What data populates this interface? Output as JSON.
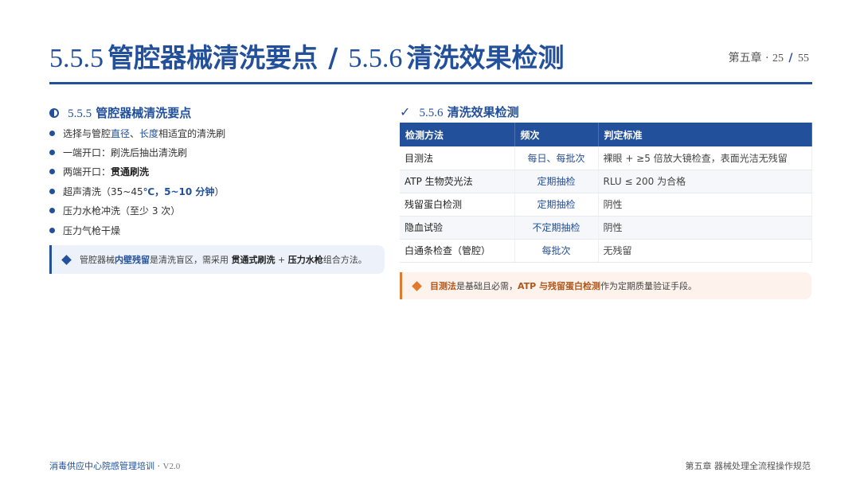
{
  "header": {
    "title_num_1": "5.5.5",
    "title_text_1": "管腔器械清洗要点",
    "title_sep": "/",
    "title_num_2": "5.5.6",
    "title_text_2": "清洗效果检测",
    "chapter": "第五章",
    "dot": "·",
    "page_current": "25",
    "page_sep": "/",
    "page_total": "55"
  },
  "left": {
    "heading_num": "5.5.5",
    "heading_text": "管腔器械清洗要点",
    "bullets": [
      {
        "a": "选择与管腔",
        "b": "直径",
        "c": "、",
        "d": "长度",
        "e": "相适宜的清洗刷"
      },
      {
        "text": "一端开口：刷洗后抽出清洗刷"
      },
      {
        "a": "两端开口：",
        "b": "贯通刷洗"
      },
      {
        "a": "超声清洗（35~45",
        "b": "℃，5~10 分钟",
        "c": "）"
      },
      {
        "text": "压力水枪冲洗（至少 3 次）"
      },
      {
        "text": "压力气枪干燥"
      }
    ],
    "note": {
      "a": "管腔器械",
      "b": "内壁残留",
      "c": "是清洗盲区，需采用 ",
      "d": "贯通式刷洗",
      "e": " + ",
      "f": "压力水枪",
      "g": "组合方法。"
    }
  },
  "right": {
    "heading_num": "5.5.6",
    "heading_text": "清洗效果检测",
    "table": {
      "headers": [
        "检测方法",
        "频次",
        "判定标准"
      ],
      "rows": [
        {
          "method": "目测法",
          "freq": "每日、每批次",
          "crit": "裸眼 + ≥5 倍放大镜检查，表面光洁无残留"
        },
        {
          "method": "ATP 生物荧光法",
          "freq": "定期抽检",
          "crit": "RLU ≤ 200 为合格"
        },
        {
          "method": "残留蛋白检测",
          "freq": "定期抽检",
          "crit": "阴性"
        },
        {
          "method": "隐血试验",
          "freq": "不定期抽检",
          "crit": "阴性"
        },
        {
          "method": "白通条检查（管腔）",
          "freq": "每批次",
          "crit": "无残留"
        }
      ]
    },
    "note": {
      "a": "目测法",
      "b": "是基础且必需，",
      "c": "ATP 与残留蛋白检测",
      "d": "作为定期质量验证手段。"
    }
  },
  "footer": {
    "left": "消毒供应中心院感管理培训",
    "left_dot": " · ",
    "version": "V2.0",
    "right": "第五章 器械处理全流程操作规范"
  },
  "colors": {
    "primary": "#23509a",
    "accent": "#e07a2e"
  },
  "icons": {
    "left_heading": "half-circle-icon",
    "right_heading": "check-icon",
    "bullet": "bullet-dot-icon",
    "note_left": "diamond-icon",
    "note_right": "diamond-icon"
  }
}
